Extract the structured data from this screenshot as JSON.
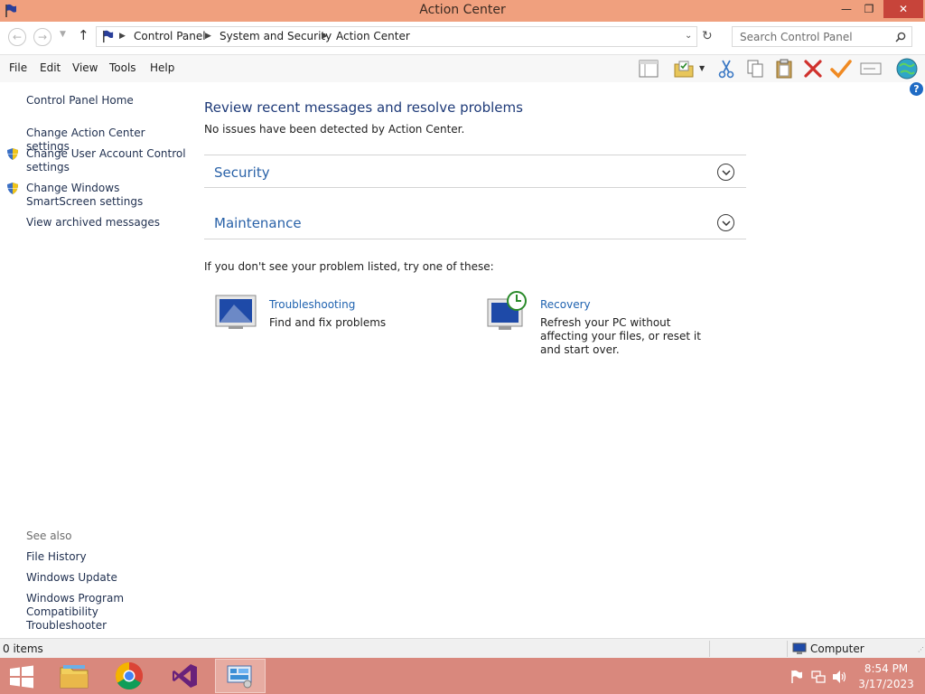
{
  "window": {
    "title": "Action Center",
    "minimize_glyph": "—",
    "restore_glyph": "❐",
    "close_glyph": "✕"
  },
  "address": {
    "crumbs": [
      "Control Panel",
      "System and Security",
      "Action Center"
    ],
    "search_placeholder": "Search Control Panel"
  },
  "menu": [
    "File",
    "Edit",
    "View",
    "Tools",
    "Help"
  ],
  "sidebar": {
    "home": "Control Panel Home",
    "links": [
      "Change Action Center settings",
      "Change User Account Control settings",
      "Change Windows SmartScreen settings",
      "View archived messages"
    ],
    "see_also_label": "See also",
    "see_also": [
      "File History",
      "Windows Update",
      "Windows Program Compatibility Troubleshooter"
    ]
  },
  "main": {
    "heading": "Review recent messages and resolve problems",
    "status": "No issues have been detected by Action Center.",
    "sections": [
      "Security",
      "Maintenance"
    ],
    "try_label": "If you don't see your problem listed, try one of these:",
    "options": [
      {
        "title": "Troubleshooting",
        "desc": "Find and fix problems"
      },
      {
        "title": "Recovery",
        "desc": "Refresh your PC without affecting your files, or reset it and start over."
      }
    ]
  },
  "statusbar": {
    "items": "0 items",
    "location": "Computer"
  },
  "taskbar": {
    "time": "8:54 PM",
    "date": "3/17/2023"
  },
  "colors": {
    "titlebar": "#f0a07e",
    "taskbar": "#d9887d",
    "link": "#2063b0",
    "heading": "#1e3a78"
  }
}
